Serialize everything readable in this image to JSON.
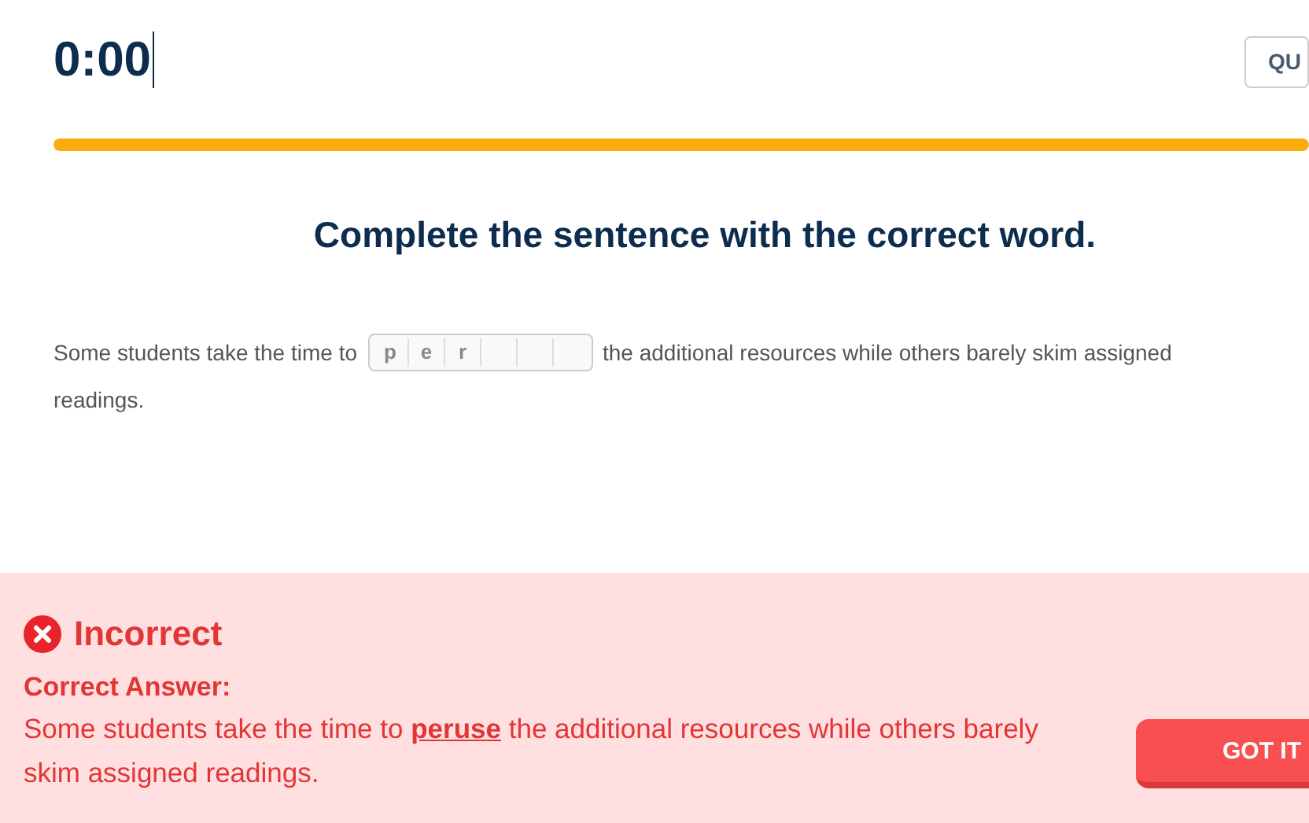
{
  "timer": "0:00",
  "quit_button": "QU",
  "progress": {
    "level": 1
  },
  "instruction": "Complete the sentence with the correct word.",
  "sentence": {
    "before": "Some students take the time to",
    "after_lines": [
      "the additional resources while others barely skim assigned",
      "readings."
    ],
    "cells": [
      {
        "kind": "letter",
        "letter": "p"
      },
      {
        "kind": "letter",
        "letter": "e"
      },
      {
        "kind": "letter",
        "letter": "r"
      },
      {
        "kind": "empty"
      },
      {
        "kind": "empty"
      },
      {
        "kind": "empty"
      }
    ]
  },
  "feedback": {
    "status": "Incorrect",
    "correct": false,
    "label": "Correct Answer:",
    "answer": "Some students take the time to **peruse** the additional resources while others barely skim assigned readings.",
    "button": "GOT IT"
  }
}
